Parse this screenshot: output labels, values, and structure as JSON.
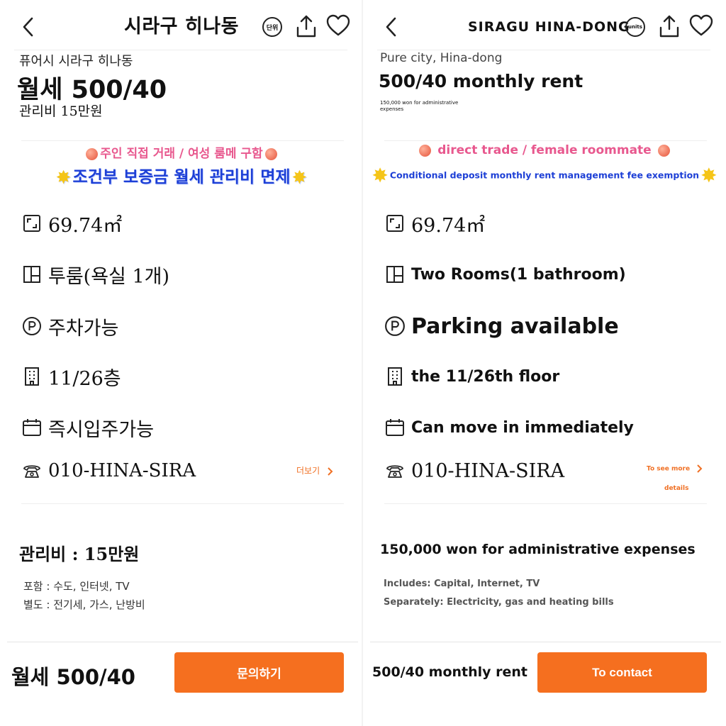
{
  "colors": {
    "accent": "#f56f1f",
    "link": "#f07024",
    "banner_pink": "#e8588e",
    "banner_blue": "#1d3fd6",
    "star": "#f5c518"
  },
  "left": {
    "header": {
      "title": "시라구 히나동",
      "unit_label": "단위"
    },
    "location": "퓨어시 시라구 히나동",
    "price": "월세 500/40",
    "mgmt": "관리비 15만원",
    "banner1": "주인 직접 거래 / 여성 룸메 구함",
    "banner2": "조건부 보증금 월세 관리비 면제",
    "area": "69.74㎡",
    "rooms": "투룸(욕실 1개)",
    "parking": "주차가능",
    "floor": "11/26층",
    "move_in": "즉시입주가능",
    "phone": "010-HINA-SIRA",
    "more_link": "더보기",
    "fee_title": "관리비 : 15만원",
    "fee_includes": "포함 : 수도, 인터넷, TV",
    "fee_separate": "별도 : 전기세, 가스, 난방비",
    "bottom_price": "월세 500/40",
    "contact": "문의하기"
  },
  "right": {
    "header": {
      "title": "SIRAGU HINA-DONG",
      "unit_label": "units"
    },
    "location": "Pure city, Hina-dong",
    "price": "500/40 monthly rent",
    "mgmt": "150,000 won for administrative expenses",
    "banner1": "direct trade / female roommate",
    "banner2": "Conditional deposit monthly rent management fee exemption",
    "area": "69.74㎡",
    "rooms": "Two Rooms(1 bathroom)",
    "parking": "Parking available",
    "floor": "the 11/26th floor",
    "move_in": "Can move in immediately",
    "phone": "010-HINA-SIRA",
    "more_link": "To see more",
    "more_link2": "details",
    "fee_title": "150,000 won for administrative expenses",
    "fee_includes": "Includes: Capital, Internet, TV",
    "fee_separate": "Separately: Electricity, gas and heating bills",
    "bottom_price": "500/40 monthly rent",
    "contact": "To contact"
  },
  "icons": [
    "back-icon",
    "unit-icon",
    "share-icon",
    "heart-icon",
    "area-icon",
    "room-icon",
    "parking-icon",
    "building-icon",
    "calendar-icon",
    "phone-icon",
    "chevron-right-icon",
    "peach-icon",
    "star-icon"
  ]
}
